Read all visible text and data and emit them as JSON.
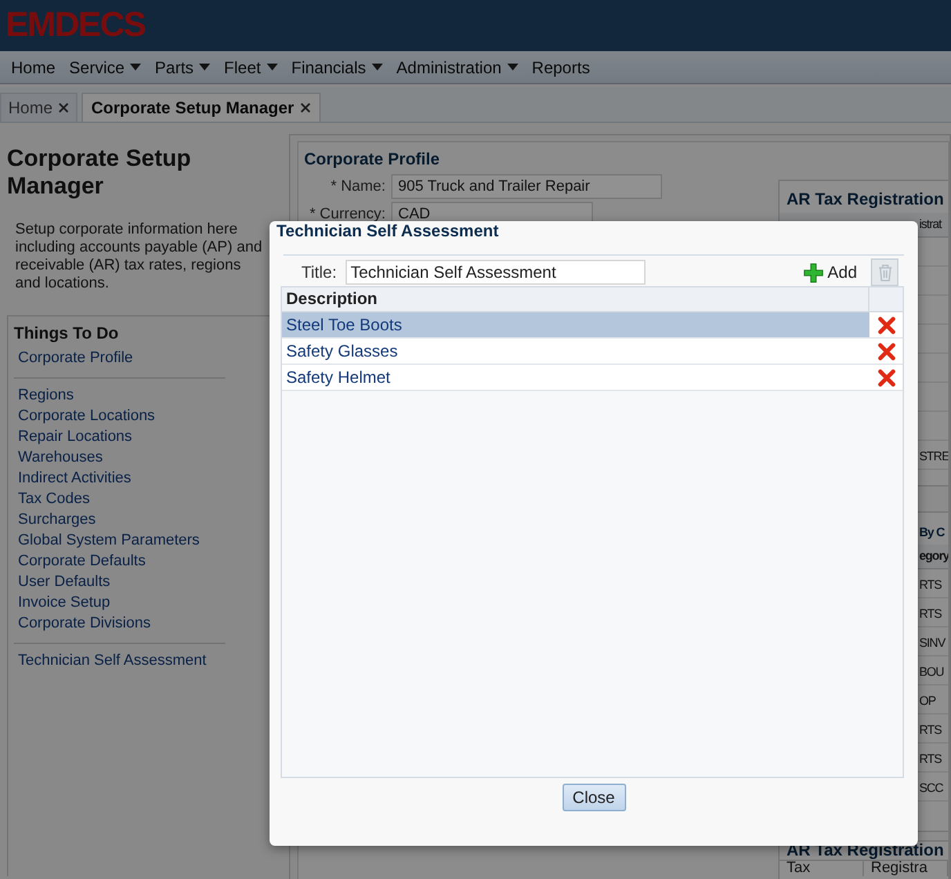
{
  "logo": "EMDECS",
  "menu": [
    {
      "label": "Home",
      "has_menu": false
    },
    {
      "label": "Service",
      "has_menu": true
    },
    {
      "label": "Parts",
      "has_menu": true
    },
    {
      "label": "Fleet",
      "has_menu": true
    },
    {
      "label": "Financials",
      "has_menu": true
    },
    {
      "label": "Administration",
      "has_menu": true
    },
    {
      "label": "Reports",
      "has_menu": false
    }
  ],
  "tabs": [
    {
      "label": "Home",
      "selected": false
    },
    {
      "label": "Corporate Setup Manager",
      "selected": true
    }
  ],
  "page": {
    "title": "Corporate Setup Manager",
    "description": "Setup corporate information here including accounts payable (AP) and receivable (AR) tax rates, regions and locations."
  },
  "things_to_do": {
    "heading": "Things To Do",
    "groups": [
      [
        "Corporate Profile"
      ],
      [
        "Regions",
        "Corporate Locations",
        "Repair Locations",
        "Warehouses",
        "Indirect Activities",
        "Tax Codes",
        "Surcharges",
        "Global System Parameters",
        "Corporate Defaults",
        "User Defaults",
        "Invoice Setup",
        "Corporate Divisions"
      ],
      [
        "Technician Self Assessment"
      ]
    ]
  },
  "profile": {
    "heading": "Corporate Profile",
    "fields": [
      {
        "kind": "text",
        "label": "* Name:",
        "value": "905 Truck and Trailer Repair"
      },
      {
        "kind": "select",
        "label": "* Currency:",
        "value": "CAD"
      }
    ]
  },
  "ar_tax_registration": {
    "heading": "AR Tax Registration",
    "column_2": "istrat",
    "cells": [
      "STRE"
    ]
  },
  "panel_2": {
    "heading": "By C",
    "column_1": "egory",
    "cells": [
      "RTS",
      "RTS",
      "SINV",
      "BOU",
      "OP",
      "RTS",
      "RTS",
      "SCC"
    ]
  },
  "panel_3": {
    "heading": "AR Tax Registration",
    "columns": [
      "Tax",
      "Registra"
    ]
  },
  "dialog": {
    "title": "Technician Self Assessment",
    "title_label": "Title:",
    "title_value": "Technician Self Assessment",
    "add_label": "Add",
    "delete_disabled": true,
    "column": "Description",
    "rows": [
      {
        "text": "Steel Toe Boots",
        "selected": true
      },
      {
        "text": "Safety Glasses",
        "selected": false
      },
      {
        "text": "Safety Helmet",
        "selected": false
      }
    ],
    "close_label": "Close"
  }
}
